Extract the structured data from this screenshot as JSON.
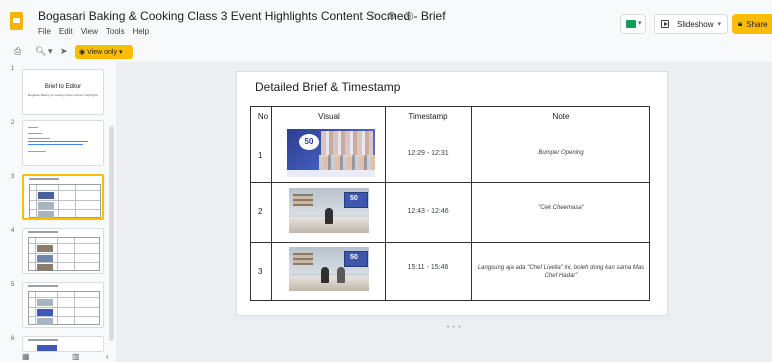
{
  "app": {
    "doc_title": "Bogasari Baking & Cooking Class 3 Event Highlights Content Socmed - Brief",
    "menu": [
      "File",
      "Edit",
      "View",
      "Tools",
      "Help"
    ],
    "slideshow_label": "Slideshow",
    "share_label": "Share",
    "view_only_label": "View only",
    "accent_color": "#fbbc04"
  },
  "filmstrip": {
    "slides": [
      {
        "num": "1",
        "title": "Brief to Editor",
        "subtitle": "Bogasari Baking & Cooking Class 3 Event Highlights"
      },
      {
        "num": "2"
      },
      {
        "num": "3"
      },
      {
        "num": "4"
      },
      {
        "num": "5"
      },
      {
        "num": "6"
      }
    ]
  },
  "slide": {
    "title": "Detailed Brief & Timestamp",
    "headers": {
      "no": "No",
      "visual": "Visual",
      "timestamp": "Timestamp",
      "note": "Note"
    },
    "rows": [
      {
        "no": "1",
        "timestamp": "12:29 - 12:31",
        "note": "Bumper Opening"
      },
      {
        "no": "2",
        "timestamp": "12:43 - 12:46",
        "note": "\"Cek Cheemasa\""
      },
      {
        "no": "3",
        "timestamp": "15:11 - 15:46",
        "note": "Langsung aja ada \"Chef Livella\" ini, boleh dong kan sama Mas Chef Hadar\""
      }
    ]
  }
}
